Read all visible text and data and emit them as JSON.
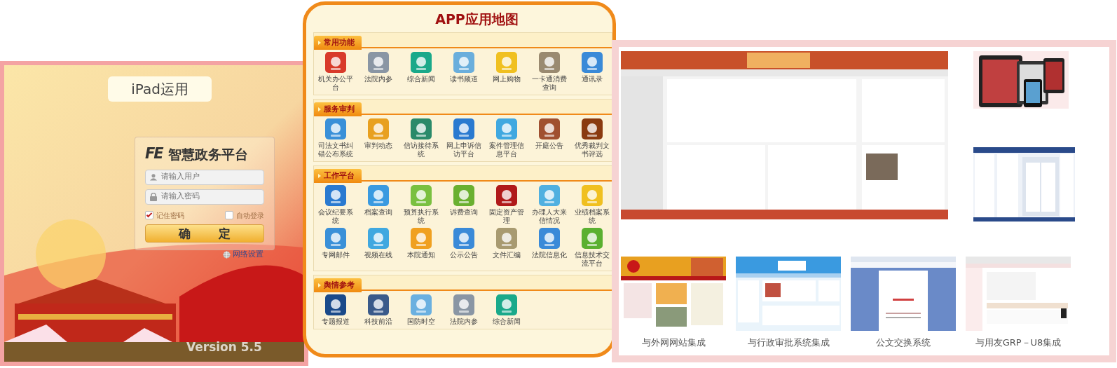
{
  "login": {
    "bubble": "iPad运用",
    "logo": "FE",
    "title": "智慧政务平台",
    "user_field": {
      "placeholder": "请输入用户"
    },
    "password_field": {
      "placeholder": "请输入密码"
    },
    "options": [
      {
        "label": "记住密码",
        "checked": true
      },
      {
        "label": "自动登录",
        "checked": false
      }
    ],
    "button": "确定",
    "network_link": "网络设置",
    "version": "Version 5.5"
  },
  "app_map": {
    "title": "APP应用地图",
    "sections": [
      {
        "title": "常用功能",
        "apps": [
          {
            "label": "机关办公平台",
            "color": "#d83a2a"
          },
          {
            "label": "法院内参",
            "color": "#8a96a4"
          },
          {
            "label": "综合新闻",
            "color": "#1aa98a"
          },
          {
            "label": "读书频道",
            "color": "#6aaedc"
          },
          {
            "label": "网上购物",
            "color": "#f0c020"
          },
          {
            "label": "一卡通消费查询",
            "color": "#9a8a70"
          },
          {
            "label": "通讯录",
            "color": "#3a8ad8"
          }
        ]
      },
      {
        "title": "服务审判",
        "apps": [
          {
            "label": "司法文书纠错公布系统",
            "color": "#3a90d8"
          },
          {
            "label": "审判动态",
            "color": "#e8a020"
          },
          {
            "label": "信访接待系统",
            "color": "#2a8a6a"
          },
          {
            "label": "网上申诉信访平台",
            "color": "#2a7ad0"
          },
          {
            "label": "案件管理信息平台",
            "color": "#40a8e0"
          },
          {
            "label": "开庭公告",
            "color": "#a05030"
          },
          {
            "label": "优秀裁判文书评选",
            "color": "#8a3a10"
          }
        ]
      },
      {
        "title": "工作平台",
        "apps": [
          {
            "label": "会议纪要系统",
            "color": "#2a7ad0"
          },
          {
            "label": "档案查询",
            "color": "#3a9ae0"
          },
          {
            "label": "预算执行系统",
            "color": "#7ac040"
          },
          {
            "label": "诉费查询",
            "color": "#6ab030"
          },
          {
            "label": "固定资产管理",
            "color": "#b01a1a"
          },
          {
            "label": "办理人大来信情况",
            "color": "#50b0e0"
          },
          {
            "label": "业绩档案系统",
            "color": "#f0c020"
          },
          {
            "label": "专网邮件",
            "color": "#3a90d8"
          },
          {
            "label": "视频在线",
            "color": "#40a8e0"
          },
          {
            "label": "本院通知",
            "color": "#f0a020"
          },
          {
            "label": "公示公告",
            "color": "#3a8ad8"
          },
          {
            "label": "文件汇编",
            "color": "#a89a70"
          },
          {
            "label": "法院信息化",
            "color": "#3a8ad8"
          },
          {
            "label": "信息技术交流平台",
            "color": "#5ab030"
          }
        ]
      },
      {
        "title": "舆情参考",
        "apps": [
          {
            "label": "专题报道",
            "color": "#1a4a8a"
          },
          {
            "label": "科技前沿",
            "color": "#3a5a8a"
          },
          {
            "label": "国防时空",
            "color": "#6ab0e0"
          },
          {
            "label": "法院内参",
            "color": "#8a96a4"
          },
          {
            "label": "综合新闻",
            "color": "#1aa98a"
          }
        ]
      }
    ]
  },
  "gallery": {
    "integrations": [
      {
        "caption": "与外网网站集成",
        "kind": "picture"
      },
      {
        "caption": "与行政审批系统集成",
        "kind": "picture"
      },
      {
        "caption": "公文交换系统",
        "kind": "picture"
      },
      {
        "caption": "与用友GRP－U8集成",
        "kind": "picture"
      }
    ]
  }
}
